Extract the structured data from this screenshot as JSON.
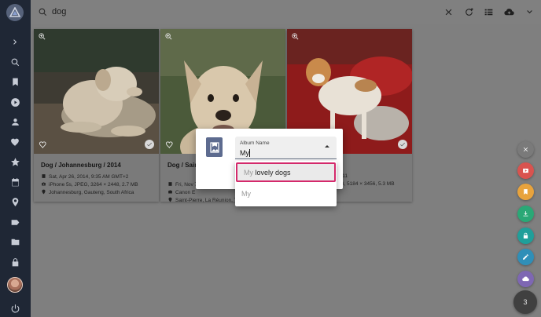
{
  "search": {
    "query": "dog"
  },
  "sidebar": {
    "items": [
      {
        "icon": "chevron-right-icon"
      },
      {
        "icon": "search-icon"
      },
      {
        "icon": "bookmark-icon"
      },
      {
        "icon": "play-circle-icon"
      },
      {
        "icon": "person-icon"
      },
      {
        "icon": "heart-icon"
      },
      {
        "icon": "star-icon"
      },
      {
        "icon": "calendar-icon"
      },
      {
        "icon": "map-pin-icon"
      },
      {
        "icon": "label-icon"
      },
      {
        "icon": "folder-icon"
      },
      {
        "icon": "lock-icon"
      },
      {
        "icon": "avatar"
      },
      {
        "icon": "power-icon"
      }
    ]
  },
  "toolbar": {
    "icons": [
      "close-icon",
      "refresh-icon",
      "view-list-icon",
      "cloud-upload-icon",
      "chevron-down-icon"
    ]
  },
  "cards": [
    {
      "title": "Dog / Johannesburg / 2014",
      "date": "Sat, Apr 26, 2014, 9:35 AM GMT+2",
      "camera": "iPhone 5s, JPEG, 3264 × 2448, 2.7 MB",
      "location": "Johannesburg, Gauteng, South Africa"
    },
    {
      "title": "Dog / Sain",
      "date": "Fri, Nov 7",
      "camera": "Canon E",
      "location": "Saint-Pierre, La Réunion, T"
    },
    {
      "title": "",
      "date": "2011",
      "camera": "EG, 5184 × 3456, 5.3 MB",
      "location": ""
    }
  ],
  "dialog": {
    "field_label": "Album Name",
    "field_value": "My"
  },
  "dropdown": {
    "items": [
      {
        "match": "My",
        "rest": " lovely dogs"
      },
      {
        "match": "My",
        "rest": ""
      }
    ]
  },
  "fabs": {
    "colors": {
      "close": "#7a7a7a",
      "red": "#d9534f",
      "orange": "#e8a33d",
      "green": "#2aa876",
      "teal": "#1f9f9a",
      "blue": "#2f8fb8",
      "purple": "#7e67b3"
    },
    "count": "3"
  },
  "colors": {
    "sidebar": "#1f2735",
    "accent": "#d4296b"
  }
}
